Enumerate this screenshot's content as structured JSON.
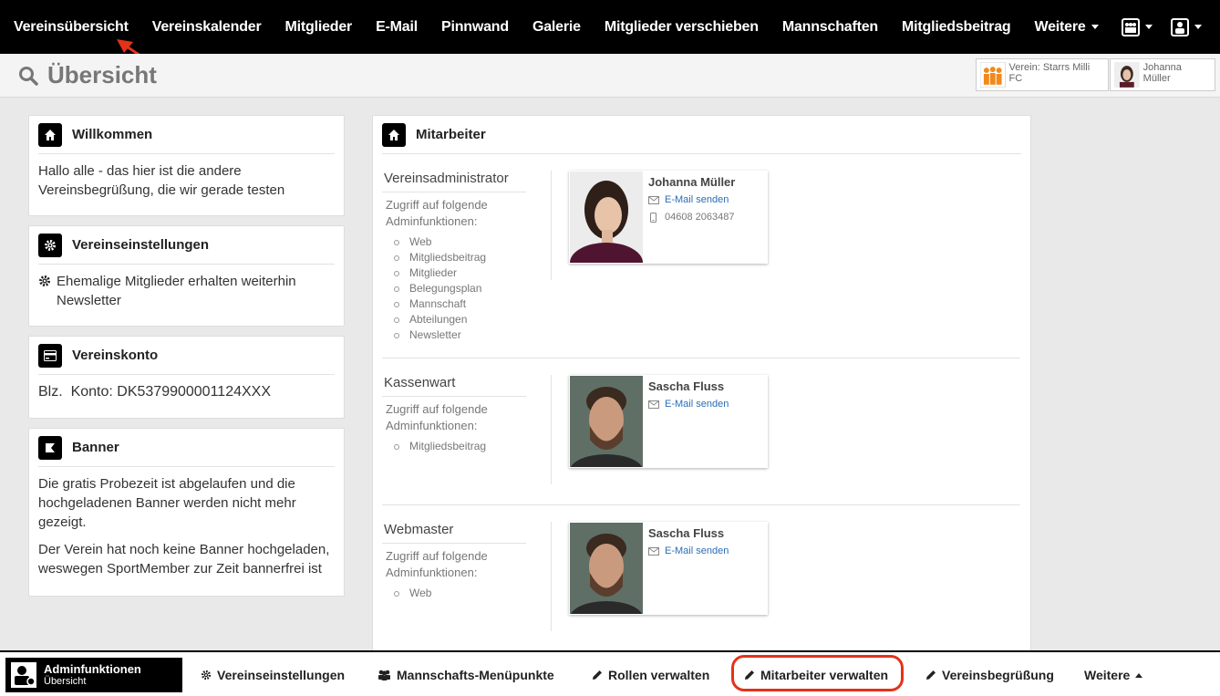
{
  "topnav": {
    "items": [
      {
        "label": "Vereinsübersicht"
      },
      {
        "label": "Vereinskalender"
      },
      {
        "label": "Mitglieder"
      },
      {
        "label": "E-Mail"
      },
      {
        "label": "Pinnwand"
      },
      {
        "label": "Galerie"
      },
      {
        "label": "Mitglieder verschieben"
      },
      {
        "label": "Mannschaften"
      },
      {
        "label": "Mitgliedsbeitrag"
      },
      {
        "label": "Weitere"
      }
    ],
    "icons": [
      "team-icon",
      "user-icon"
    ]
  },
  "header": {
    "title": "Übersicht",
    "club_label": "Verein: Starrs Milli FC",
    "user_label": "Johanna Müller"
  },
  "panels": {
    "welcome": {
      "title": "Willkommen",
      "text": "Hallo alle - das hier ist die andere Vereinsbegrüßung, die wir gerade testen"
    },
    "settings": {
      "title": "Vereinseinstellungen",
      "text": "Ehemalige Mitglieder erhalten weiterhin Newsletter"
    },
    "account": {
      "title": "Vereinskonto",
      "blz": "Blz.",
      "konto": "Konto: DK5379900001124XXX"
    },
    "banner": {
      "title": "Banner",
      "text1": "Die gratis Probezeit ist abgelaufen und die hochgeladenen Banner werden nicht mehr gezeigt.",
      "text2": "Der Verein hat noch keine Banner hochgeladen, weswegen SportMember zur Zeit bannerfrei ist"
    }
  },
  "staff": {
    "title": "Mitarbeiter",
    "roles": [
      {
        "role": "Vereinsadministrator",
        "sub": "Zugriff auf folgende Adminfunktionen:",
        "functions": [
          "Web",
          "Mitgliedsbeitrag",
          "Mitglieder",
          "Belegungsplan",
          "Mannschaft",
          "Abteilungen",
          "Newsletter"
        ],
        "name": "Johanna Müller",
        "mail": "E-Mail senden",
        "phone": "04608 2063487"
      },
      {
        "role": "Kassenwart",
        "sub": "Zugriff auf folgende Adminfunktionen:",
        "functions": [
          "Mitgliedsbeitrag"
        ],
        "name": "Sascha Fluss",
        "mail": "E-Mail senden"
      },
      {
        "role": "Webmaster",
        "sub": "Zugriff auf folgende Adminfunktionen:",
        "functions": [
          "Web"
        ],
        "name": "Sascha Fluss",
        "mail": "E-Mail senden"
      }
    ]
  },
  "bottombar": {
    "admin_title": "Adminfunktionen",
    "admin_sub": "Übersicht",
    "items": [
      {
        "label": "Vereinseinstellungen",
        "icon": "gear-icon"
      },
      {
        "label": "Mannschafts-Menüpunkte",
        "icon": "people-icon"
      },
      {
        "label": "Rollen verwalten",
        "icon": "pencil-icon"
      },
      {
        "label": "Mitarbeiter verwalten",
        "icon": "pencil-icon"
      },
      {
        "label": "Vereinsbegrüßung",
        "icon": "pencil-icon"
      },
      {
        "label": "Weitere",
        "icon": "caret-up-icon"
      }
    ]
  },
  "colors": {
    "accent": "#e4321b",
    "nav_bg": "#000000",
    "link": "#2a6db7"
  }
}
